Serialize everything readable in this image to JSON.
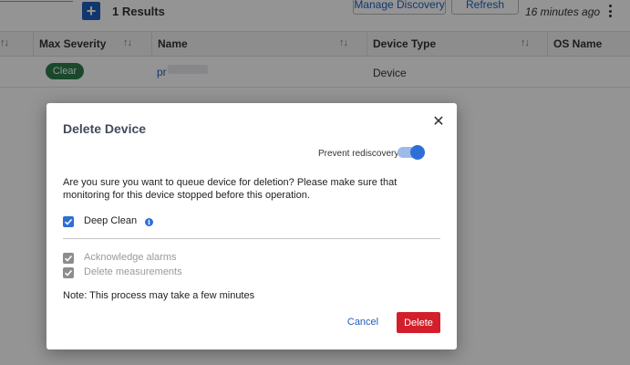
{
  "toolbar": {
    "add_icon": "plus-icon",
    "results_label": "1 Results",
    "manage_discovery_label": "Manage Discovery",
    "refresh_label": "Refresh",
    "updated_label": "16 minutes ago",
    "more_icon": "kebab-menu-icon"
  },
  "table": {
    "columns": [
      "Max Severity",
      "Name",
      "Device Type",
      "OS Name"
    ],
    "sort_icon": "↑↓",
    "rows": [
      {
        "max_severity": "Clear",
        "name": "pr",
        "device_type": "Device",
        "os_name": ""
      }
    ]
  },
  "dialog": {
    "title": "Delete Device",
    "close_icon": "close-icon",
    "prevent_rediscovery_label": "Prevent rediscovery",
    "prevent_rediscovery_on": true,
    "message": "Are you sure you want to queue device for deletion? Please make sure that monitoring for this device stopped before this operation.",
    "deep_clean_label": "Deep Clean",
    "deep_clean_checked": true,
    "info_icon": "info-icon",
    "acknowledge_alarms_label": "Acknowledge alarms",
    "acknowledge_alarms_checked": true,
    "delete_measurements_label": "Delete measurements",
    "delete_measurements_checked": true,
    "note": "Note: This process may take a few minutes",
    "cancel_label": "Cancel",
    "delete_label": "Delete"
  },
  "colors": {
    "accent": "#1f5fbf",
    "toggle": "#2d6fd6",
    "clear_badge": "#2e7d4a",
    "delete_button": "#d21f2b",
    "overlay": "rgba(0,0,0,0.42)"
  }
}
